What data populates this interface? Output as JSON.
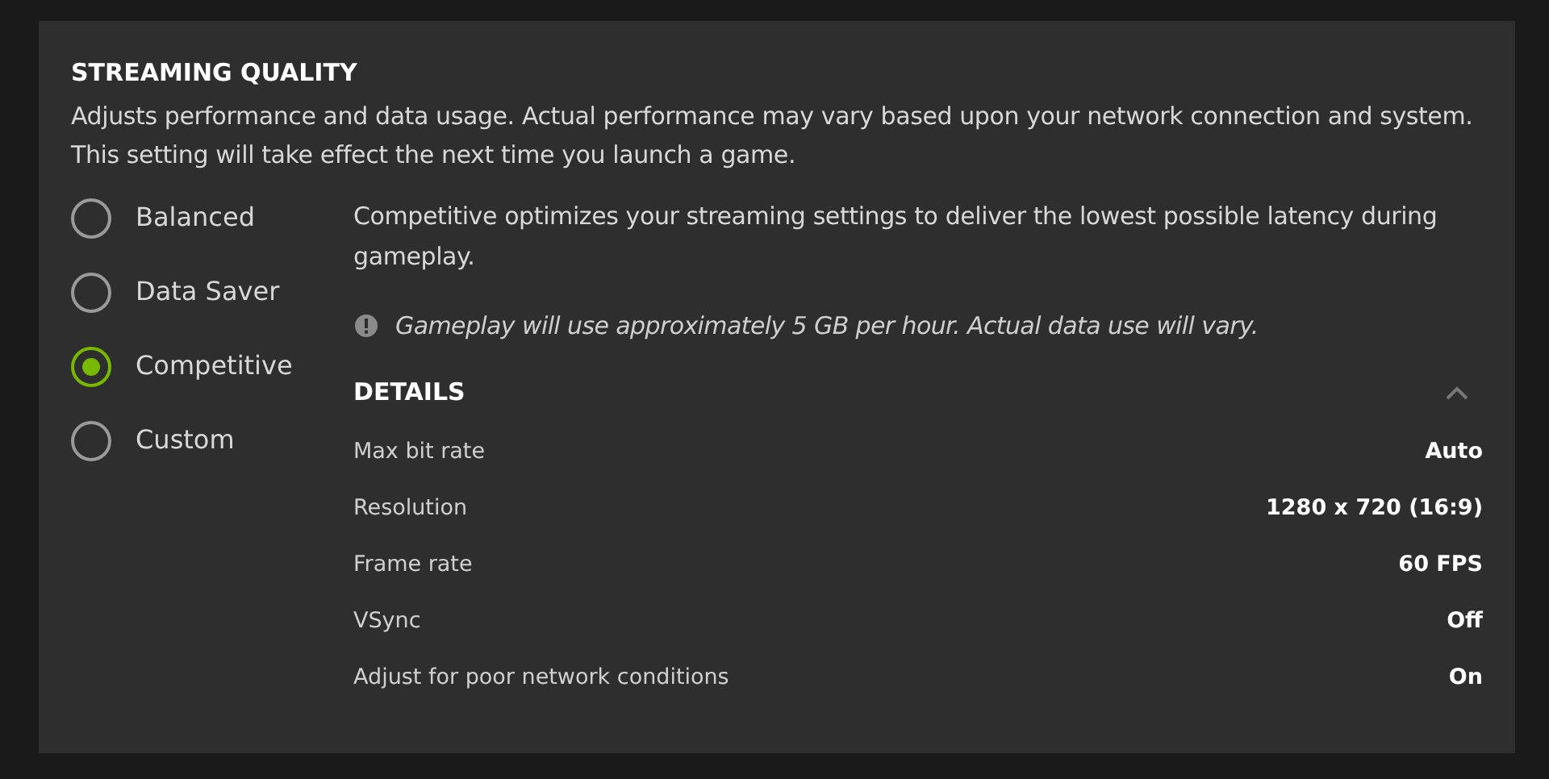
{
  "title": "STREAMING QUALITY",
  "description": "Adjusts performance and data usage. Actual performance may vary based upon your network connection and system. This setting will take effect the next time you launch a game.",
  "options": [
    {
      "label": "Balanced",
      "selected": false
    },
    {
      "label": "Data Saver",
      "selected": false
    },
    {
      "label": "Competitive",
      "selected": true
    },
    {
      "label": "Custom",
      "selected": false
    }
  ],
  "summary": "Competitive optimizes your streaming settings to deliver the lowest possible latency during gameplay.",
  "notice": "Gameplay will use approximately 5 GB per hour. Actual data use will vary.",
  "details": {
    "title": "DETAILS",
    "expanded": true,
    "rows": [
      {
        "label": "Max bit rate",
        "value": "Auto"
      },
      {
        "label": "Resolution",
        "value": "1280 x 720 (16:9)"
      },
      {
        "label": "Frame rate",
        "value": "60 FPS"
      },
      {
        "label": "VSync",
        "value": "Off"
      },
      {
        "label": "Adjust for poor network conditions",
        "value": "On"
      }
    ]
  }
}
